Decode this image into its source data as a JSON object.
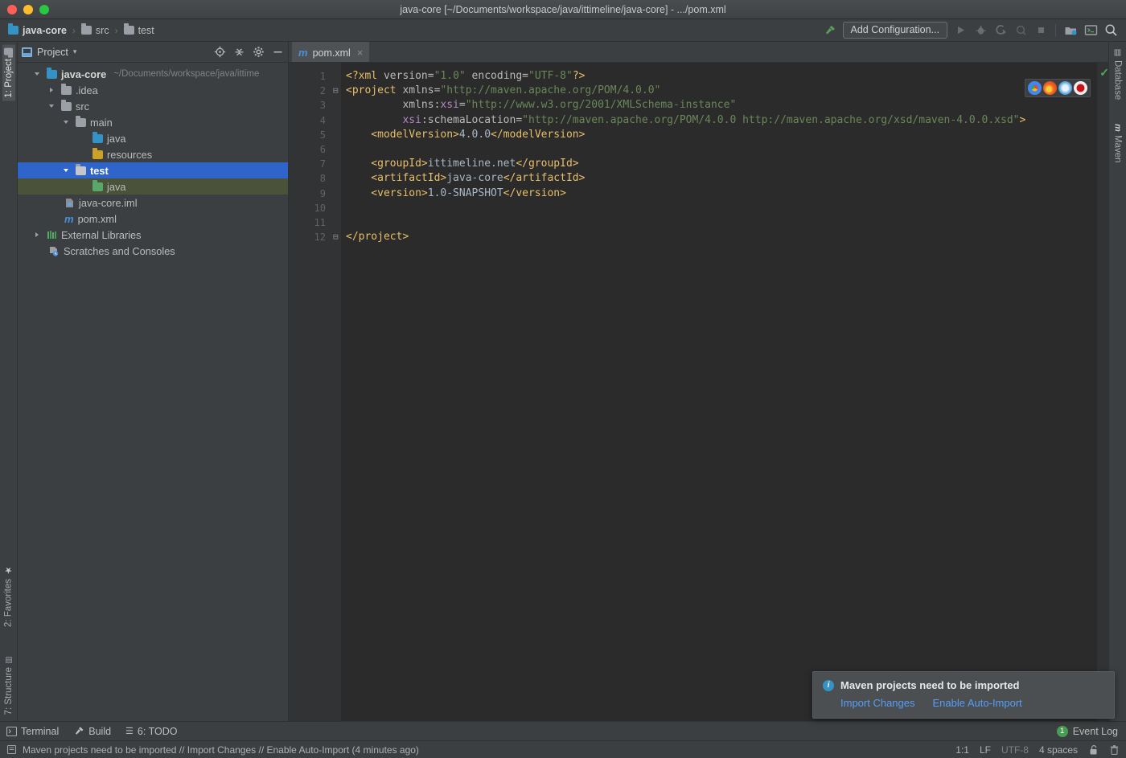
{
  "window": {
    "title": "java-core [~/Documents/workspace/java/ittimeline/java-core] - .../pom.xml",
    "traffic_lights": [
      "close",
      "minimize",
      "maximize"
    ]
  },
  "navbar": {
    "breadcrumbs": [
      {
        "label": "java-core",
        "icon": "module-folder-icon"
      },
      {
        "label": "src",
        "icon": "folder-icon"
      },
      {
        "label": "test",
        "icon": "folder-icon"
      }
    ],
    "separator": "›",
    "build_icon": "hammer-icon",
    "run_config_label": "Add Configuration...",
    "actions": [
      {
        "name": "run-button",
        "icon": "play-icon",
        "enabled": false
      },
      {
        "name": "debug-button",
        "icon": "bug-icon",
        "enabled": false
      },
      {
        "name": "run-coverage-button",
        "icon": "coverage-icon",
        "enabled": false
      },
      {
        "name": "profile-button",
        "icon": "profile-icon",
        "enabled": false
      },
      {
        "name": "stop-button",
        "icon": "stop-icon",
        "enabled": false
      },
      {
        "name": "project-structure-button",
        "icon": "project-structure-icon",
        "enabled": true
      },
      {
        "name": "terminal-button",
        "icon": "terminal-icon",
        "enabled": true
      },
      {
        "name": "search-everywhere-button",
        "icon": "search-icon",
        "enabled": true
      }
    ]
  },
  "left_stripe": {
    "top": [
      {
        "label": "1: Project",
        "icon": "project-icon",
        "active": true
      }
    ],
    "bottom": [
      {
        "label": "2: Favorites",
        "icon": "star-icon",
        "active": false
      },
      {
        "label": "7: Structure",
        "icon": "structure-icon",
        "active": false
      }
    ]
  },
  "right_stripe": {
    "items": [
      {
        "label": "Database",
        "icon": "database-icon"
      },
      {
        "label": "Maven",
        "icon": "maven-icon"
      }
    ]
  },
  "project_panel": {
    "title": "Project",
    "dropdown_caret": "▾",
    "tools": [
      {
        "name": "locate-file-icon",
        "label": "Select Opened File"
      },
      {
        "name": "collapse-all-icon",
        "label": "Collapse All"
      },
      {
        "name": "settings-gear-icon",
        "label": "Settings"
      },
      {
        "name": "hide-panel-icon",
        "label": "Hide"
      }
    ],
    "tree": [
      {
        "label": "java-core",
        "hint": "~/Documents/workspace/java/ittime",
        "indent": 0,
        "arrow": "open",
        "icon": "module-folder-icon",
        "bold": true,
        "state": "none"
      },
      {
        "label": ".idea",
        "hint": "",
        "indent": 1,
        "arrow": "closed",
        "icon": "folder-icon",
        "bold": false,
        "state": "none"
      },
      {
        "label": "src",
        "hint": "",
        "indent": 1,
        "arrow": "open",
        "icon": "folder-icon",
        "bold": false,
        "state": "none"
      },
      {
        "label": "main",
        "hint": "",
        "indent": 2,
        "arrow": "open",
        "icon": "folder-icon",
        "bold": false,
        "state": "none"
      },
      {
        "label": "java",
        "hint": "",
        "indent": 3,
        "arrow": "none",
        "icon": "source-folder-icon",
        "bold": false,
        "state": "none"
      },
      {
        "label": "resources",
        "hint": "",
        "indent": 3,
        "arrow": "none",
        "icon": "resources-folder-icon",
        "bold": false,
        "state": "none"
      },
      {
        "label": "test",
        "hint": "",
        "indent": 2,
        "arrow": "open",
        "icon": "folder-icon",
        "bold": true,
        "state": "selected"
      },
      {
        "label": "java",
        "hint": "",
        "indent": 3,
        "arrow": "none",
        "icon": "test-source-folder-icon",
        "bold": false,
        "state": "highlighted"
      },
      {
        "label": "java-core.iml",
        "hint": "",
        "indent": 2,
        "arrow": "none",
        "icon": "iml-file-icon",
        "bold": false,
        "state": "none"
      },
      {
        "label": "pom.xml",
        "hint": "",
        "indent": 2,
        "arrow": "none",
        "icon": "maven-file-icon",
        "bold": false,
        "state": "none"
      },
      {
        "label": "External Libraries",
        "hint": "",
        "indent": 1,
        "arrow": "closed",
        "icon": "libraries-icon",
        "bold": false,
        "state": "none"
      },
      {
        "label": "Scratches and Consoles",
        "hint": "",
        "indent": 1,
        "arrow": "none",
        "icon": "scratches-icon",
        "bold": false,
        "state": "none"
      }
    ]
  },
  "editor": {
    "tab": {
      "label": "pom.xml",
      "icon": "maven-file-icon",
      "close": "×"
    },
    "line_numbers": [
      "1",
      "2",
      "3",
      "4",
      "5",
      "6",
      "7",
      "8",
      "9",
      "10",
      "11",
      "12"
    ],
    "lines": [
      {
        "n": 1,
        "tokens": [
          {
            "t": "<?xml",
            "c": "pi"
          },
          {
            "t": " version=",
            "c": "attr"
          },
          {
            "t": "\"1.0\"",
            "c": "str"
          },
          {
            "t": " encoding=",
            "c": "attr"
          },
          {
            "t": "\"UTF-8\"",
            "c": "str"
          },
          {
            "t": "?>",
            "c": "pi"
          }
        ]
      },
      {
        "n": 2,
        "tokens": [
          {
            "t": "<project",
            "c": "tag"
          },
          {
            "t": " xmlns=",
            "c": "attr"
          },
          {
            "t": "\"http://maven.apache.org/POM/4.0.0\"",
            "c": "str"
          }
        ]
      },
      {
        "n": 3,
        "tokens": [
          {
            "t": "         xmlns:",
            "c": "attr"
          },
          {
            "t": "xsi",
            "c": "ns"
          },
          {
            "t": "=",
            "c": "attr"
          },
          {
            "t": "\"http://www.w3.org/2001/XMLSchema-instance\"",
            "c": "str"
          }
        ]
      },
      {
        "n": 4,
        "tokens": [
          {
            "t": "         ",
            "c": "attr"
          },
          {
            "t": "xsi",
            "c": "ns"
          },
          {
            "t": ":schemaLocation=",
            "c": "attr"
          },
          {
            "t": "\"http://maven.apache.org/POM/4.0.0 http://maven.apache.org/xsd/maven-4.0.0.xsd\"",
            "c": "str"
          },
          {
            "t": ">",
            "c": "tag"
          }
        ]
      },
      {
        "n": 5,
        "tokens": [
          {
            "t": "    <modelVersion>",
            "c": "tag"
          },
          {
            "t": "4.0.0",
            "c": "txt"
          },
          {
            "t": "</modelVersion>",
            "c": "tag"
          }
        ]
      },
      {
        "n": 6,
        "tokens": [
          {
            "t": "",
            "c": "txt"
          }
        ]
      },
      {
        "n": 7,
        "tokens": [
          {
            "t": "    <groupId>",
            "c": "tag"
          },
          {
            "t": "ittimeline.net",
            "c": "txt"
          },
          {
            "t": "</groupId>",
            "c": "tag"
          }
        ]
      },
      {
        "n": 8,
        "tokens": [
          {
            "t": "    <artifactId>",
            "c": "tag"
          },
          {
            "t": "java-core",
            "c": "txt"
          },
          {
            "t": "</artifactId>",
            "c": "tag"
          }
        ]
      },
      {
        "n": 9,
        "tokens": [
          {
            "t": "    <version>",
            "c": "tag"
          },
          {
            "t": "1.0-SNAPSHOT",
            "c": "txt"
          },
          {
            "t": "</version>",
            "c": "tag"
          }
        ]
      },
      {
        "n": 10,
        "tokens": [
          {
            "t": "",
            "c": "txt"
          }
        ]
      },
      {
        "n": 11,
        "tokens": [
          {
            "t": "",
            "c": "txt"
          }
        ]
      },
      {
        "n": 12,
        "tokens": [
          {
            "t": "</project>",
            "c": "tag"
          }
        ]
      }
    ],
    "browsers": [
      {
        "name": "chrome-icon",
        "color": "#4285f4"
      },
      {
        "name": "firefox-icon",
        "color": "#e66000"
      },
      {
        "name": "safari-icon",
        "color": "#1b88ca"
      },
      {
        "name": "opera-icon",
        "color": "#cc0f16"
      }
    ],
    "inspection_status": "✓"
  },
  "notification": {
    "icon": "info-icon",
    "icon_glyph": "i",
    "title": "Maven projects need to be imported",
    "actions": [
      {
        "label": "Import Changes"
      },
      {
        "label": "Enable Auto-Import"
      }
    ]
  },
  "tool_windows": {
    "items": [
      {
        "label": "Terminal",
        "icon": "terminal-icon"
      },
      {
        "label": "Build",
        "icon": "hammer-icon"
      },
      {
        "label": "6: TODO",
        "icon": "todo-icon"
      }
    ],
    "event_log": {
      "label": "Event Log",
      "count": "1"
    }
  },
  "statusbar": {
    "icon": "message-icon",
    "message": "Maven projects need to be imported // Import Changes // Enable Auto-Import (4 minutes ago)",
    "caret": "1:1",
    "line_separator": "LF",
    "encoding": "UTF-8",
    "indent": "4 spaces",
    "lock_icon": "unlocked-icon",
    "trash_icon": "trash-icon"
  },
  "colors": {
    "accent_blue": "#2f65ca",
    "link_blue": "#589df6",
    "green_badge": "#499c54",
    "panel_bg": "#3c3f41",
    "editor_bg": "#2b2b2b"
  }
}
